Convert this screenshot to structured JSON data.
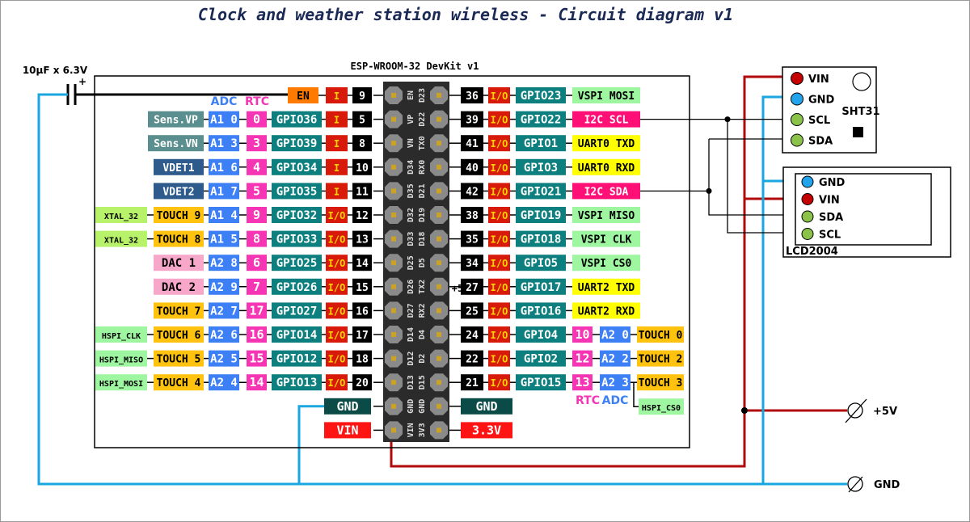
{
  "title": "Clock and weather station wireless - Circuit diagram v1",
  "board": {
    "name": "ESP-WROOM-32 DevKit v1",
    "header_left_labels": [
      "EN",
      "VP",
      "VN",
      "D34",
      "D35",
      "D32",
      "D33",
      "D25",
      "D26",
      "D27",
      "D14",
      "D12",
      "D13",
      "GND",
      "VIN"
    ],
    "header_right_labels": [
      "D23",
      "D22",
      "TX0",
      "RX0",
      "D21",
      "D19",
      "D18",
      "D5",
      "TX2",
      "RX2",
      "D4",
      "D2",
      "D15",
      "GND",
      "3V3"
    ],
    "adc_label": "ADC",
    "rtc_label": "RTC",
    "rtc_label_bottom": "RTC",
    "adc_label_bottom": "ADC",
    "left_pins": [
      {
        "func": "",
        "touch": "",
        "adc": "",
        "rtc": "",
        "gpio": "EN",
        "dir": "I",
        "num": "9",
        "special": "en"
      },
      {
        "func": "Sens.VP",
        "func_type": "sens",
        "touch": "",
        "adc": "A1 0",
        "rtc": "0",
        "gpio": "GPIO36",
        "dir": "I",
        "num": "5"
      },
      {
        "func": "Sens.VN",
        "func_type": "sens",
        "touch": "",
        "adc": "A1 3",
        "rtc": "3",
        "gpio": "GPIO39",
        "dir": "I",
        "num": "8"
      },
      {
        "func": "VDET1",
        "func_type": "vdet",
        "touch": "",
        "adc": "A1 6",
        "rtc": "4",
        "gpio": "GPIO34",
        "dir": "I",
        "num": "10"
      },
      {
        "func": "VDET2",
        "func_type": "vdet",
        "touch": "",
        "adc": "A1 7",
        "rtc": "5",
        "gpio": "GPIO35",
        "dir": "I",
        "num": "11"
      },
      {
        "extra": "XTAL_32",
        "touch": "TOUCH 9",
        "adc": "A1 4",
        "rtc": "9",
        "gpio": "GPIO32",
        "dir": "I/O",
        "num": "12"
      },
      {
        "extra": "XTAL_32",
        "touch": "TOUCH 8",
        "adc": "A1 5",
        "rtc": "8",
        "gpio": "GPIO33",
        "dir": "I/O",
        "num": "13"
      },
      {
        "dac": "DAC 1",
        "adc": "A2 8",
        "rtc": "6",
        "gpio": "GPIO25",
        "dir": "I/O",
        "num": "14"
      },
      {
        "dac": "DAC 2",
        "adc": "A2 9",
        "rtc": "7",
        "gpio": "GPIO26",
        "dir": "I/O",
        "num": "15"
      },
      {
        "touch": "TOUCH 7",
        "adc": "A2 7",
        "rtc": "17",
        "gpio": "GPIO27",
        "dir": "I/O",
        "num": "16"
      },
      {
        "extra": "HSPI_CLK",
        "touch": "TOUCH 6",
        "adc": "A2 6",
        "rtc": "16",
        "gpio": "GPIO14",
        "dir": "I/O",
        "num": "17"
      },
      {
        "extra": "HSPI_MISO",
        "touch": "TOUCH 5",
        "adc": "A2 5",
        "rtc": "15",
        "gpio": "GPIO12",
        "dir": "I/O",
        "num": "18"
      },
      {
        "extra": "HSPI_MOSI",
        "touch": "TOUCH 4",
        "adc": "A2 4",
        "rtc": "14",
        "gpio": "GPIO13",
        "dir": "I/O",
        "num": "20"
      },
      {
        "power": "GND",
        "power_type": "gnd"
      },
      {
        "power": "VIN",
        "power_type": "vin"
      }
    ],
    "right_pins": [
      {
        "num": "36",
        "dir": "I/O",
        "gpio": "GPIO23",
        "func": "VSPI MOSI",
        "func_type": "vspi"
      },
      {
        "num": "39",
        "dir": "I/O",
        "gpio": "GPIO22",
        "func": "I2C SCL",
        "func_type": "i2c"
      },
      {
        "num": "41",
        "dir": "I/O",
        "gpio": "GPIO1",
        "func": "UART0 TXD",
        "func_type": "uart"
      },
      {
        "num": "40",
        "dir": "I/O",
        "gpio": "GPIO3",
        "func": "UART0 RXD",
        "func_type": "uart"
      },
      {
        "num": "42",
        "dir": "I/O",
        "gpio": "GPIO21",
        "func": "I2C SDA",
        "func_type": "i2c"
      },
      {
        "num": "38",
        "dir": "I/O",
        "gpio": "GPIO19",
        "func": "VSPI MISO",
        "func_type": "vspi"
      },
      {
        "num": "35",
        "dir": "I/O",
        "gpio": "GPIO18",
        "func": "VSPI CLK",
        "func_type": "vspi"
      },
      {
        "num": "34",
        "dir": "I/O",
        "gpio": "GPIO5",
        "func": "VSPI CS0",
        "func_type": "vspi"
      },
      {
        "num": "27",
        "dir": "I/O",
        "gpio": "GPIO17",
        "func": "UART2 TXD",
        "func_type": "uart"
      },
      {
        "num": "25",
        "dir": "I/O",
        "gpio": "GPIO16",
        "func": "UART2 RXD",
        "func_type": "uart"
      },
      {
        "num": "24",
        "dir": "I/O",
        "gpio": "GPIO4",
        "rtc": "10",
        "adc": "A2 0",
        "touch": "TOUCH 0"
      },
      {
        "num": "22",
        "dir": "I/O",
        "gpio": "GPIO2",
        "rtc": "12",
        "adc": "A2 2",
        "touch": "TOUCH 2"
      },
      {
        "num": "21",
        "dir": "I/O",
        "gpio": "GPIO15",
        "rtc": "13",
        "adc": "A2 3",
        "touch": "TOUCH 3",
        "extra": "HSPI_CS0"
      },
      {
        "power": "GND",
        "power_type": "gnd"
      },
      {
        "power": "3.3V",
        "power_type": "v33"
      }
    ]
  },
  "capacitor": {
    "label": "10µF x 6.3V",
    "polarity": "+"
  },
  "sht31": {
    "name": "SHT31",
    "pins": [
      "VIN",
      "GND",
      "SCL",
      "SDA"
    ]
  },
  "lcd": {
    "name": "LCD2004",
    "pins": [
      "GND",
      "VIN",
      "SDA",
      "SCL"
    ]
  },
  "terminals": {
    "vplus": "+5V",
    "gnd": "GND"
  },
  "stray_label": "+5",
  "colors": {
    "vin_wire": "#b00a0a",
    "gnd_wire": "#1aa7e0",
    "signal_wire": "#000000",
    "pin_vin": "#c40000",
    "pin_gnd": "#22a4ec",
    "pin_signal": "#8bc34a",
    "sens": "#5b8f8f",
    "vdet": "#2e5b8c",
    "touch": "#ffc20e",
    "adc": "#3d7ff5",
    "rtc": "#f535b4",
    "gpio": "#0e7f7f",
    "dir": "#d71a0a",
    "dir_text": "#ffd400",
    "num": "#000000",
    "xtal": "#b8f26a",
    "hspi": "#9ef7a0",
    "dac": "#f7a7c9",
    "vspi": "#9ef7a0",
    "i2c": "#ff0f76",
    "uart": "#ffff00",
    "en": "#ff7a00",
    "gnd_box": "#0b4b47",
    "vin_box": "#ff1414",
    "header": "#2b2b2b",
    "title": "#1b2a55"
  }
}
